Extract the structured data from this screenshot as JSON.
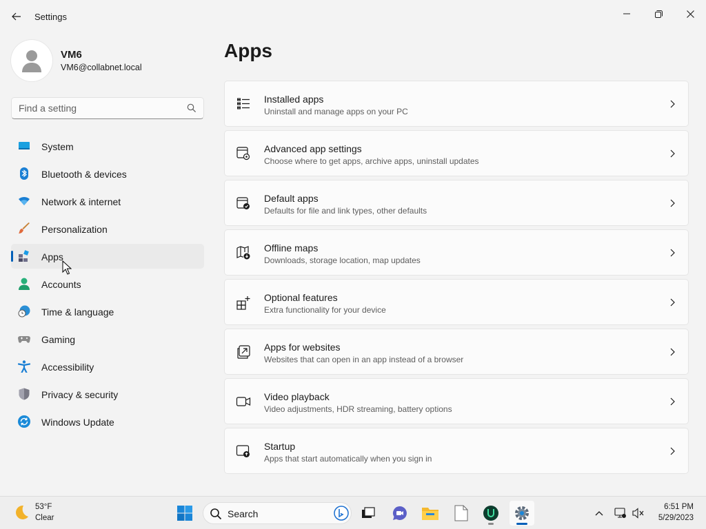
{
  "window": {
    "title": "Settings",
    "controls": {
      "minimize": "minimize-icon",
      "maximize": "restore-icon",
      "close": "close-icon"
    }
  },
  "profile": {
    "name": "VM6",
    "email": "VM6@collabnet.local"
  },
  "search": {
    "placeholder": "Find a setting"
  },
  "sidebar": {
    "items": [
      {
        "label": "System",
        "icon": "system-icon"
      },
      {
        "label": "Bluetooth & devices",
        "icon": "bluetooth-icon"
      },
      {
        "label": "Network & internet",
        "icon": "wifi-icon"
      },
      {
        "label": "Personalization",
        "icon": "brush-icon"
      },
      {
        "label": "Apps",
        "icon": "apps-icon",
        "active": true
      },
      {
        "label": "Accounts",
        "icon": "person-icon"
      },
      {
        "label": "Time & language",
        "icon": "globe-clock-icon"
      },
      {
        "label": "Gaming",
        "icon": "gamepad-icon"
      },
      {
        "label": "Accessibility",
        "icon": "accessibility-icon"
      },
      {
        "label": "Privacy & security",
        "icon": "shield-icon"
      },
      {
        "label": "Windows Update",
        "icon": "update-icon"
      }
    ]
  },
  "main": {
    "title": "Apps",
    "cards": [
      {
        "title": "Installed apps",
        "subtitle": "Uninstall and manage apps on your PC",
        "icon": "list-icon"
      },
      {
        "title": "Advanced app settings",
        "subtitle": "Choose where to get apps, archive apps, uninstall updates",
        "icon": "app-settings-icon"
      },
      {
        "title": "Default apps",
        "subtitle": "Defaults for file and link types, other defaults",
        "icon": "default-apps-icon"
      },
      {
        "title": "Offline maps",
        "subtitle": "Downloads, storage location, map updates",
        "icon": "map-download-icon"
      },
      {
        "title": "Optional features",
        "subtitle": "Extra functionality for your device",
        "icon": "add-grid-icon"
      },
      {
        "title": "Apps for websites",
        "subtitle": "Websites that can open in an app instead of a browser",
        "icon": "open-in-app-icon"
      },
      {
        "title": "Video playback",
        "subtitle": "Video adjustments, HDR streaming, battery options",
        "icon": "video-icon"
      },
      {
        "title": "Startup",
        "subtitle": "Apps that start automatically when you sign in",
        "icon": "startup-icon"
      }
    ]
  },
  "taskbar": {
    "weather": {
      "temp": "53°F",
      "condition": "Clear",
      "icon": "moon-icon"
    },
    "search_label": "Search",
    "clock": {
      "time": "6:51 PM",
      "date": "5/29/2023"
    }
  },
  "colors": {
    "accent": "#005fb8",
    "background": "#f3f3f3",
    "card": "#fbfbfb"
  }
}
